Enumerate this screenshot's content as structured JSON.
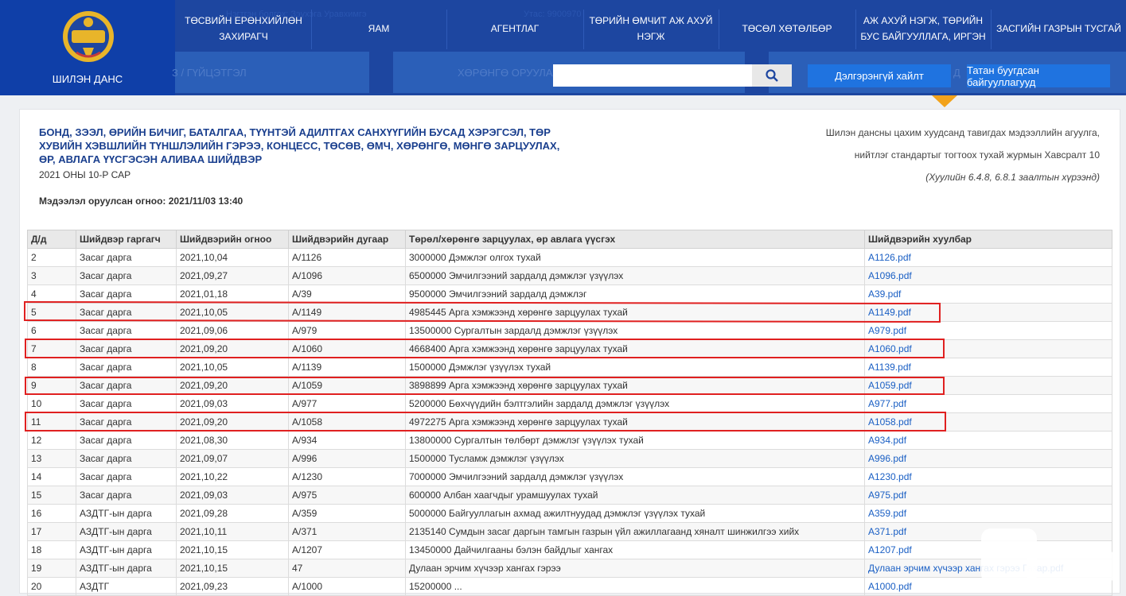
{
  "header": {
    "logo_text": "ШИЛЭН ДАНС",
    "ghost_left": "Нэгтгэн болгох: Зэүхэга Уравхимгэ",
    "ghost_right": "Утас: 9900970",
    "nav": [
      {
        "line1": "ТӨСВИЙН ЕРӨНХИЙЛӨН",
        "line2": "ЗАХИРАГЧ"
      },
      {
        "line1": "ЯАМ",
        "line2": ""
      },
      {
        "line1": "АГЕНТЛАГ",
        "line2": ""
      },
      {
        "line1": "ТӨРИЙН ӨМЧИТ АЖ АХУЙ",
        "line2": "НЭГЖ"
      },
      {
        "line1": "ТӨСӨЛ ХӨТӨЛБӨР",
        "line2": ""
      },
      {
        "line1": "АЖ АХУЙ НЭГЖ, ТӨРИЙН",
        "line2": "БУС БАЙГУУЛЛАГА, ИРГЭН"
      },
      {
        "line1": "ЗАСГИЙН ГАЗРЫН ТУСГАЙ",
        "line2": ""
      }
    ],
    "sub_left": "З / ГҮЙЦЭТГЭЛ",
    "sub_mid": "ХӨРӨНГӨ ОРУУЛАЛТ",
    "sub_right": "Д",
    "search_placeholder": "",
    "advanced_search": "Дэлгэрэнгүй хайлт",
    "recipients": "Татан буугдсан байгууллагууд"
  },
  "doc": {
    "title": "БОНД, ЗЭЭЛ, ӨРИЙН БИЧИГ, БАТАЛГАА, ТҮҮНТЭЙ АДИЛТГАХ САНХҮҮГИЙН БУСАД ХЭРЭГСЭЛ, ТӨР ХУВИЙН ХЭВШЛИЙН ТҮНШЛЭЛИЙН ГЭРЭЭ, КОНЦЕСС, ТӨСӨВ, ӨМЧ, ХӨРӨНГӨ, МӨНГӨ ЗАРЦУУЛАХ, ӨР, АВЛАГА ҮҮСГЭСЭН АЛИВАА ШИЙДВЭР",
    "subtitle": "2021 ОНЫ 10-Р САР",
    "date_line": "Мэдээлэл оруулсан огноо: 2021/11/03 13:40",
    "note_line1": "Шилэн дансны цахим хуудсанд тавигдах мэдээллийн агуулга,",
    "note_line2": "нийтлэг стандартыг тогтоох тухай журмын Хавсралт 10",
    "note_line3": "(Хуулийн 6.4.8, 6.8.1 заалтын хүрээнд)"
  },
  "table": {
    "headers": [
      "Д/д",
      "Шийдвэр гаргагч",
      "Шийдвэрийн огноо",
      "Шийдвэрийн дугаар",
      "Төрөл/хөрөнгө зарцуулах, өр авлага үүсгэх",
      "Шийдвэрийн хуулбар"
    ],
    "rows": [
      [
        "2",
        "Засаг дарга",
        "2021,10,04",
        "А/1126",
        "3000000 Дэмжлэг олгох тухай",
        "A1126.pdf"
      ],
      [
        "3",
        "Засаг дарга",
        "2021,09,27",
        "А/1096",
        "6500000 Эмчилгээний зардалд дэмжлэг үзүүлэх",
        "A1096.pdf"
      ],
      [
        "4",
        "Засаг дарга",
        "2021,01,18",
        "А/39",
        "9500000 Эмчилгээний зардалд дэмжлэг",
        "A39.pdf"
      ],
      [
        "5",
        "Засаг дарга",
        "2021,10,05",
        "А/1149",
        "4985445 Арга хэмжээнд хөрөнгө зарцуулах тухай",
        "A1149.pdf"
      ],
      [
        "6",
        "Засаг дарга",
        "2021,09,06",
        "А/979",
        "13500000 Сургалтын зардалд дэмжлэг үзүүлэх",
        "A979.pdf"
      ],
      [
        "7",
        "Засаг дарга",
        "2021,09,20",
        "А/1060",
        "4668400 Арга хэмжээнд хөрөнгө зарцуулах тухай",
        "A1060.pdf"
      ],
      [
        "8",
        "Засаг дарга",
        "2021,10,05",
        "А/1139",
        "1500000 Дэмжлэг үзүүлэх тухай",
        "A1139.pdf"
      ],
      [
        "9",
        "Засаг дарга",
        "2021,09,20",
        "А/1059",
        "3898899 Арга хэмжээнд хөрөнгө зарцуулах тухай",
        "A1059.pdf"
      ],
      [
        "10",
        "Засаг дарга",
        "2021,09,03",
        "А/977",
        "5200000 Бөхчүүдийн бэлтгэлийн зардалд дэмжлэг үзүүлэх",
        "A977.pdf"
      ],
      [
        "11",
        "Засаг дарга",
        "2021,09,20",
        "А/1058",
        "4972275 Арга хэмжээнд хөрөнгө зарцуулах тухай",
        "A1058.pdf"
      ],
      [
        "12",
        "Засаг дарга",
        "2021,08,30",
        "А/934",
        "13800000 Сургалтын төлбөрт дэмжлэг үзүүлэх тухай",
        "A934.pdf"
      ],
      [
        "13",
        "Засаг дарга",
        "2021,09,07",
        "А/996",
        "1500000 Тусламж дэмжлэг үзүүлэх",
        "A996.pdf"
      ],
      [
        "14",
        "Засаг дарга",
        "2021,10,22",
        "А/1230",
        "7000000 Эмчилгээний зардалд дэмжлэг үзүүлэх",
        "A1230.pdf"
      ],
      [
        "15",
        "Засаг дарга",
        "2021,09,03",
        "А/975",
        "600000 Албан хаагчдыг урамшуулах тухай",
        "A975.pdf"
      ],
      [
        "16",
        "АЗДТГ-ын дарга",
        "2021,09,28",
        "А/359",
        "5000000 Байгууллагын ахмад ажилтнуудад дэмжлэг үзүүлэх тухай",
        "A359.pdf"
      ],
      [
        "17",
        "АЗДТГ-ын дарга",
        "2021,10,11",
        "А/371",
        "2135140 Сумдын засаг даргын тамгын газрын үйл ажиллагаанд хяналт шинжилгээ хийх",
        "A371.pdf"
      ],
      [
        "18",
        "АЗДТГ-ын дарга",
        "2021,10,15",
        "А/1207",
        "13450000 Дайчилгааны бэлэн байдлыг хангах",
        "A1207.pdf"
      ],
      [
        "19",
        "АЗДТГ-ын дарга",
        "2021,10,15",
        "47",
        "Дулаан эрчим хүчээр хангах гэрээ",
        "Дулаан эрчим хүчээр хангах гэрээ Газар.pdf"
      ],
      [
        "20",
        "АЗДТГ",
        "2021,09,23",
        "А/1000",
        "15200000 ...",
        "A1000.pdf"
      ]
    ]
  },
  "colors": {
    "header_bg": "#1d46a0",
    "logo_bg": "#0f3fa8",
    "button_blue": "#1f73e0",
    "link": "#1a5fc4",
    "highlight_red": "#e02020",
    "caret_orange": "#f2a21b"
  }
}
